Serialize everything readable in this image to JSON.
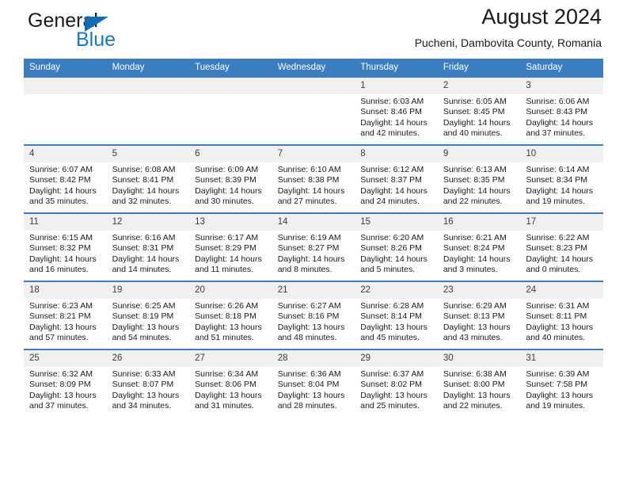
{
  "brand": {
    "name_part1": "General",
    "name_part2": "Blue",
    "accent_color": "#1878c4",
    "triangle_color": "#0f6cb6"
  },
  "header": {
    "title": "August 2024",
    "subtitle": "Pucheni, Dambovita County, Romania"
  },
  "calendar": {
    "header_bg": "#3a7ebf",
    "daynum_bg": "#f0f0f0",
    "weekday_headers": [
      "Sunday",
      "Monday",
      "Tuesday",
      "Wednesday",
      "Thursday",
      "Friday",
      "Saturday"
    ],
    "weeks": [
      [
        {
          "day": "",
          "empty": true
        },
        {
          "day": "",
          "empty": true
        },
        {
          "day": "",
          "empty": true
        },
        {
          "day": "",
          "empty": true
        },
        {
          "day": "1",
          "sunrise": "Sunrise: 6:03 AM",
          "sunset": "Sunset: 8:46 PM",
          "daylight_line1": "Daylight: 14 hours",
          "daylight_line2": "and 42 minutes."
        },
        {
          "day": "2",
          "sunrise": "Sunrise: 6:05 AM",
          "sunset": "Sunset: 8:45 PM",
          "daylight_line1": "Daylight: 14 hours",
          "daylight_line2": "and 40 minutes."
        },
        {
          "day": "3",
          "sunrise": "Sunrise: 6:06 AM",
          "sunset": "Sunset: 8:43 PM",
          "daylight_line1": "Daylight: 14 hours",
          "daylight_line2": "and 37 minutes."
        }
      ],
      [
        {
          "day": "4",
          "sunrise": "Sunrise: 6:07 AM",
          "sunset": "Sunset: 8:42 PM",
          "daylight_line1": "Daylight: 14 hours",
          "daylight_line2": "and 35 minutes."
        },
        {
          "day": "5",
          "sunrise": "Sunrise: 6:08 AM",
          "sunset": "Sunset: 8:41 PM",
          "daylight_line1": "Daylight: 14 hours",
          "daylight_line2": "and 32 minutes."
        },
        {
          "day": "6",
          "sunrise": "Sunrise: 6:09 AM",
          "sunset": "Sunset: 8:39 PM",
          "daylight_line1": "Daylight: 14 hours",
          "daylight_line2": "and 30 minutes."
        },
        {
          "day": "7",
          "sunrise": "Sunrise: 6:10 AM",
          "sunset": "Sunset: 8:38 PM",
          "daylight_line1": "Daylight: 14 hours",
          "daylight_line2": "and 27 minutes."
        },
        {
          "day": "8",
          "sunrise": "Sunrise: 6:12 AM",
          "sunset": "Sunset: 8:37 PM",
          "daylight_line1": "Daylight: 14 hours",
          "daylight_line2": "and 24 minutes."
        },
        {
          "day": "9",
          "sunrise": "Sunrise: 6:13 AM",
          "sunset": "Sunset: 8:35 PM",
          "daylight_line1": "Daylight: 14 hours",
          "daylight_line2": "and 22 minutes."
        },
        {
          "day": "10",
          "sunrise": "Sunrise: 6:14 AM",
          "sunset": "Sunset: 8:34 PM",
          "daylight_line1": "Daylight: 14 hours",
          "daylight_line2": "and 19 minutes."
        }
      ],
      [
        {
          "day": "11",
          "sunrise": "Sunrise: 6:15 AM",
          "sunset": "Sunset: 8:32 PM",
          "daylight_line1": "Daylight: 14 hours",
          "daylight_line2": "and 16 minutes."
        },
        {
          "day": "12",
          "sunrise": "Sunrise: 6:16 AM",
          "sunset": "Sunset: 8:31 PM",
          "daylight_line1": "Daylight: 14 hours",
          "daylight_line2": "and 14 minutes."
        },
        {
          "day": "13",
          "sunrise": "Sunrise: 6:17 AM",
          "sunset": "Sunset: 8:29 PM",
          "daylight_line1": "Daylight: 14 hours",
          "daylight_line2": "and 11 minutes."
        },
        {
          "day": "14",
          "sunrise": "Sunrise: 6:19 AM",
          "sunset": "Sunset: 8:27 PM",
          "daylight_line1": "Daylight: 14 hours",
          "daylight_line2": "and 8 minutes."
        },
        {
          "day": "15",
          "sunrise": "Sunrise: 6:20 AM",
          "sunset": "Sunset: 8:26 PM",
          "daylight_line1": "Daylight: 14 hours",
          "daylight_line2": "and 5 minutes."
        },
        {
          "day": "16",
          "sunrise": "Sunrise: 6:21 AM",
          "sunset": "Sunset: 8:24 PM",
          "daylight_line1": "Daylight: 14 hours",
          "daylight_line2": "and 3 minutes."
        },
        {
          "day": "17",
          "sunrise": "Sunrise: 6:22 AM",
          "sunset": "Sunset: 8:23 PM",
          "daylight_line1": "Daylight: 14 hours",
          "daylight_line2": "and 0 minutes."
        }
      ],
      [
        {
          "day": "18",
          "sunrise": "Sunrise: 6:23 AM",
          "sunset": "Sunset: 8:21 PM",
          "daylight_line1": "Daylight: 13 hours",
          "daylight_line2": "and 57 minutes."
        },
        {
          "day": "19",
          "sunrise": "Sunrise: 6:25 AM",
          "sunset": "Sunset: 8:19 PM",
          "daylight_line1": "Daylight: 13 hours",
          "daylight_line2": "and 54 minutes."
        },
        {
          "day": "20",
          "sunrise": "Sunrise: 6:26 AM",
          "sunset": "Sunset: 8:18 PM",
          "daylight_line1": "Daylight: 13 hours",
          "daylight_line2": "and 51 minutes."
        },
        {
          "day": "21",
          "sunrise": "Sunrise: 6:27 AM",
          "sunset": "Sunset: 8:16 PM",
          "daylight_line1": "Daylight: 13 hours",
          "daylight_line2": "and 48 minutes."
        },
        {
          "day": "22",
          "sunrise": "Sunrise: 6:28 AM",
          "sunset": "Sunset: 8:14 PM",
          "daylight_line1": "Daylight: 13 hours",
          "daylight_line2": "and 45 minutes."
        },
        {
          "day": "23",
          "sunrise": "Sunrise: 6:29 AM",
          "sunset": "Sunset: 8:13 PM",
          "daylight_line1": "Daylight: 13 hours",
          "daylight_line2": "and 43 minutes."
        },
        {
          "day": "24",
          "sunrise": "Sunrise: 6:31 AM",
          "sunset": "Sunset: 8:11 PM",
          "daylight_line1": "Daylight: 13 hours",
          "daylight_line2": "and 40 minutes."
        }
      ],
      [
        {
          "day": "25",
          "sunrise": "Sunrise: 6:32 AM",
          "sunset": "Sunset: 8:09 PM",
          "daylight_line1": "Daylight: 13 hours",
          "daylight_line2": "and 37 minutes."
        },
        {
          "day": "26",
          "sunrise": "Sunrise: 6:33 AM",
          "sunset": "Sunset: 8:07 PM",
          "daylight_line1": "Daylight: 13 hours",
          "daylight_line2": "and 34 minutes."
        },
        {
          "day": "27",
          "sunrise": "Sunrise: 6:34 AM",
          "sunset": "Sunset: 8:06 PM",
          "daylight_line1": "Daylight: 13 hours",
          "daylight_line2": "and 31 minutes."
        },
        {
          "day": "28",
          "sunrise": "Sunrise: 6:36 AM",
          "sunset": "Sunset: 8:04 PM",
          "daylight_line1": "Daylight: 13 hours",
          "daylight_line2": "and 28 minutes."
        },
        {
          "day": "29",
          "sunrise": "Sunrise: 6:37 AM",
          "sunset": "Sunset: 8:02 PM",
          "daylight_line1": "Daylight: 13 hours",
          "daylight_line2": "and 25 minutes."
        },
        {
          "day": "30",
          "sunrise": "Sunrise: 6:38 AM",
          "sunset": "Sunset: 8:00 PM",
          "daylight_line1": "Daylight: 13 hours",
          "daylight_line2": "and 22 minutes."
        },
        {
          "day": "31",
          "sunrise": "Sunrise: 6:39 AM",
          "sunset": "Sunset: 7:58 PM",
          "daylight_line1": "Daylight: 13 hours",
          "daylight_line2": "and 19 minutes."
        }
      ]
    ]
  }
}
